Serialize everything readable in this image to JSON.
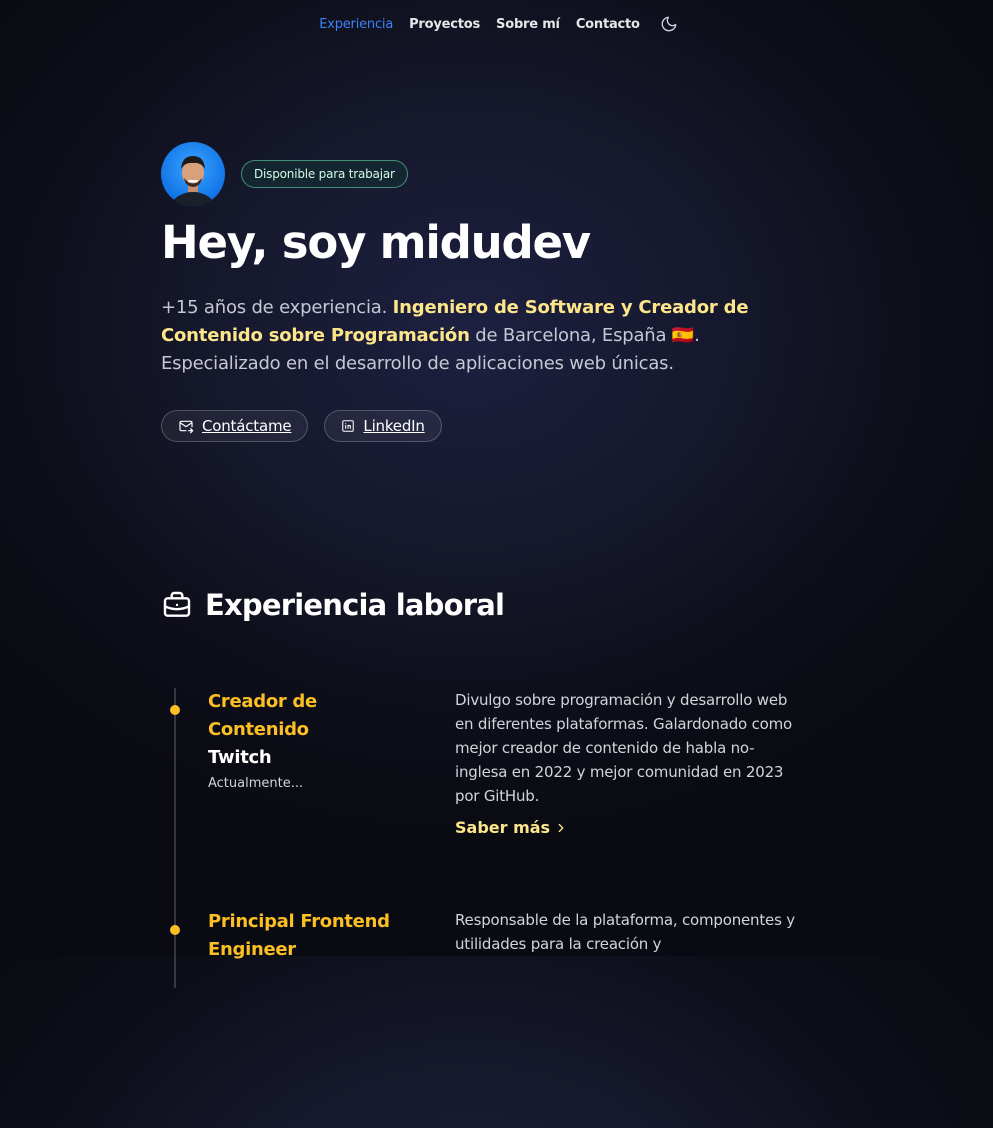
{
  "nav": {
    "items": [
      {
        "label": "Experiencia",
        "active": true
      },
      {
        "label": "Proyectos",
        "active": false
      },
      {
        "label": "Sobre mí",
        "active": false
      },
      {
        "label": "Contacto",
        "active": false
      }
    ],
    "theme_icon": "moon-icon"
  },
  "hero": {
    "avatar_icon": "avatar",
    "badge": "Disponible para trabajar",
    "title": "Hey, soy midudev",
    "desc_part1": "+15 años de experiencia. ",
    "desc_highlight": "Ingeniero de Software y Creador de Contenido sobre Programación",
    "desc_part2": " de Barcelona, España ",
    "desc_flag": "🇪🇸",
    "desc_part3": ". Especializado en el desarrollo de aplicaciones web únicas.",
    "buttons": {
      "contact": {
        "label": "Contáctame",
        "icon": "mail-icon"
      },
      "linkedin": {
        "label": "LinkedIn",
        "icon": "linkedin-icon"
      }
    }
  },
  "experience": {
    "title": "Experiencia laboral",
    "icon": "briefcase-icon",
    "items": [
      {
        "role": "Creador de Contenido",
        "company": "Twitch",
        "date": "Actualmente...",
        "description": "Divulgo sobre programación y desarrollo web en diferentes plataformas. Galardonado como mejor creador de contenido de habla no-inglesa en 2022 y mejor comunidad en 2023 por GitHub.",
        "more": "Saber más"
      },
      {
        "role": "Principal Frontend Engineer",
        "company": "",
        "date": "",
        "description": "Responsable de la plataforma, componentes y utilidades para la creación y",
        "more": ""
      }
    ]
  },
  "colors": {
    "accent_blue": "#3b82f6",
    "highlight_yellow": "#fde68a",
    "timeline_yellow": "#fbbf24",
    "badge_green": "#6ee7b7"
  }
}
